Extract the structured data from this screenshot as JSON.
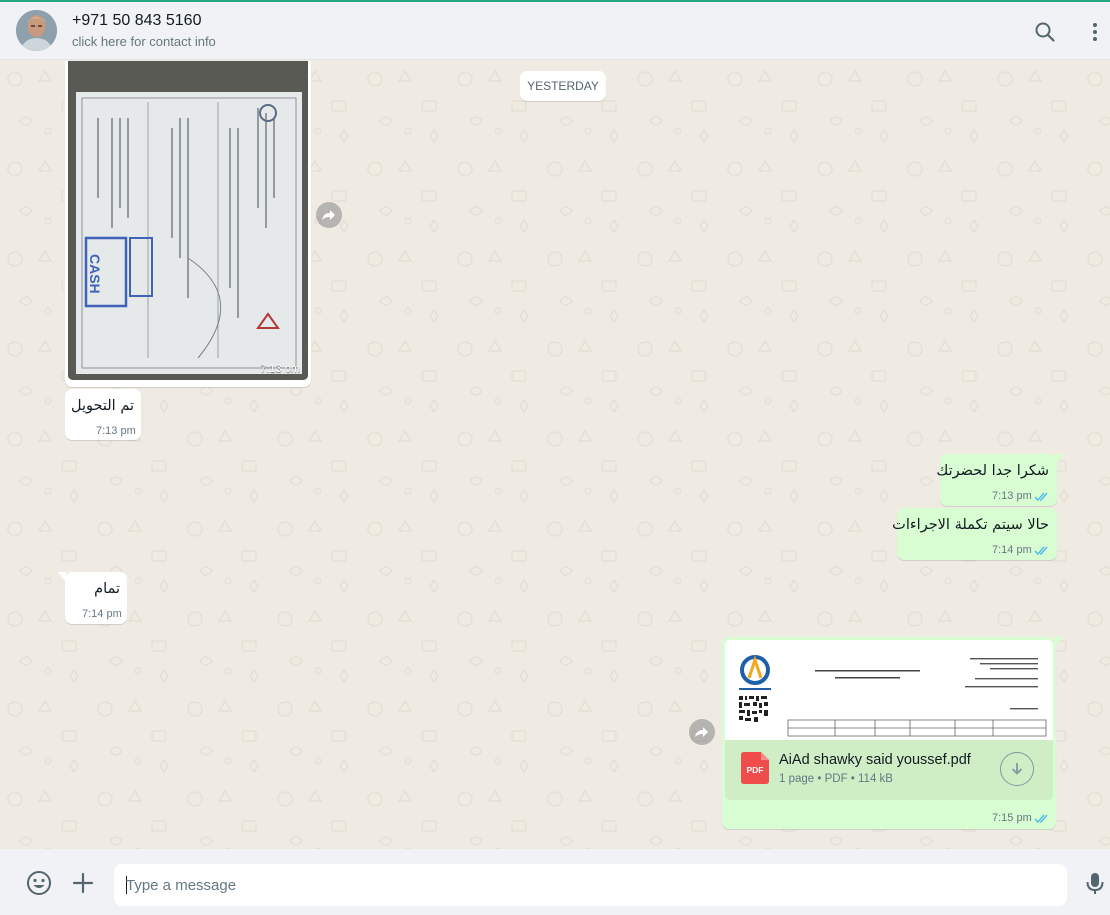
{
  "header": {
    "contact_name": "+971 50 843 5160",
    "contact_subtitle": "click here for contact info",
    "icons": [
      "search-icon",
      "menu-icon"
    ]
  },
  "chat": {
    "date_separator": "YESTERDAY",
    "messages": [
      {
        "direction": "incoming",
        "type": "image",
        "time": "7:13 pm",
        "image_text": "CASH",
        "forwardable": true
      },
      {
        "direction": "incoming",
        "type": "text",
        "text": "تم التحويل",
        "time": "7:13 pm"
      },
      {
        "direction": "outgoing",
        "type": "text",
        "text": "شكرا جدا لحضرتك",
        "time": "7:13 pm",
        "status": "read"
      },
      {
        "direction": "outgoing",
        "type": "text",
        "text": "حالا سيتم تكملة الاجراءات",
        "time": "7:14 pm",
        "status": "read"
      },
      {
        "direction": "incoming",
        "type": "text",
        "text": "تمام",
        "time": "7:14 pm"
      },
      {
        "direction": "outgoing",
        "type": "document",
        "file_name": "AiAd shawky said youssef.pdf",
        "file_meta": "1 page • PDF • 114 kB",
        "file_badge": "PDF",
        "time": "7:15 pm",
        "status": "read",
        "forwardable": true
      }
    ]
  },
  "composer": {
    "placeholder": "Type a message",
    "icons": [
      "emoji-icon",
      "attach-plus-icon",
      "microphone-icon"
    ]
  },
  "colors": {
    "accent": "#25a884",
    "outgoing_bubble": "#d9fdd3",
    "incoming_bubble": "#ffffff",
    "read_ticks": "#53bdeb",
    "chat_background": "#efeae2"
  }
}
